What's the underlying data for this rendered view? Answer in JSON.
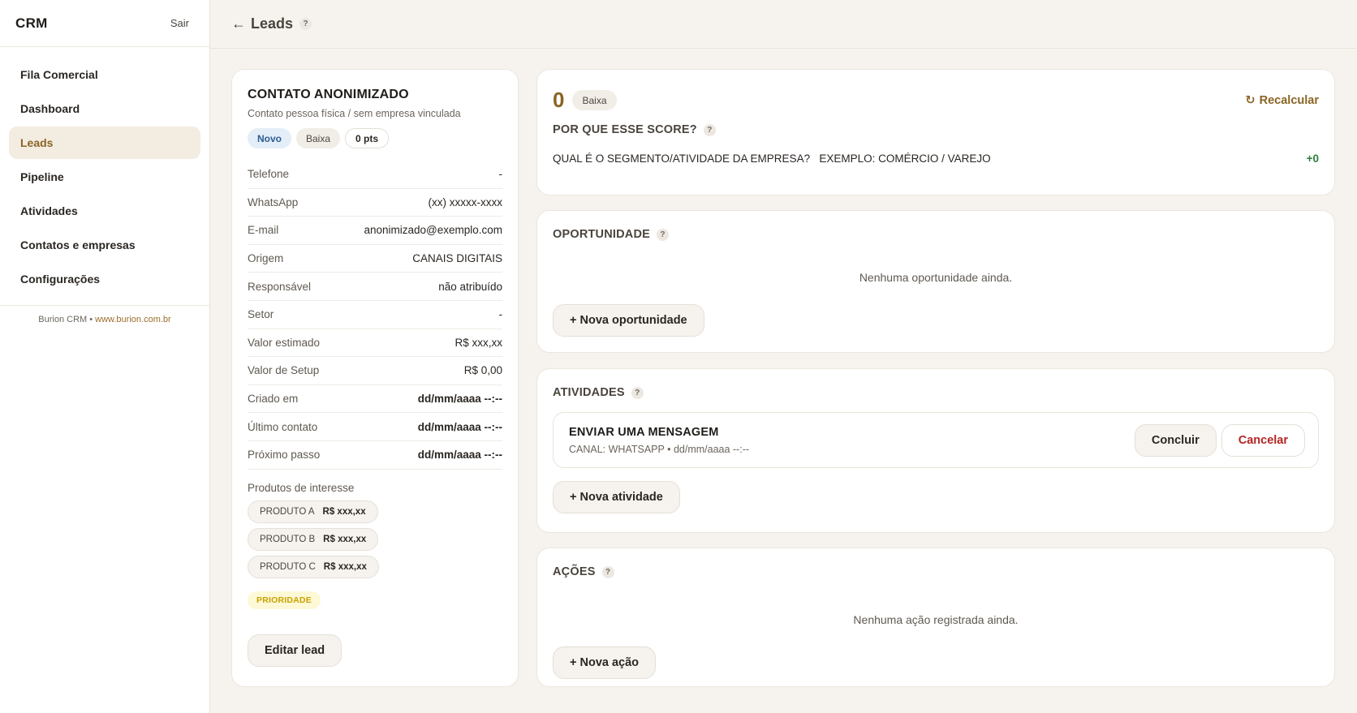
{
  "app": {
    "brand": "CRM",
    "logout": "Sair"
  },
  "sidebar": {
    "items": [
      {
        "label": "Fila Comercial"
      },
      {
        "label": "Dashboard"
      },
      {
        "label": "Leads"
      },
      {
        "label": "Pipeline"
      },
      {
        "label": "Atividades"
      },
      {
        "label": "Contatos e empresas"
      },
      {
        "label": "Configurações"
      }
    ],
    "active_index": 2,
    "footer_text": "Burion CRM • ",
    "footer_link": "www.burion.com.br"
  },
  "header": {
    "back_arrow": "←",
    "title": "Leads",
    "help": "?"
  },
  "lead": {
    "title": "CONTATO ANONIMIZADO",
    "subtitle": "Contato pessoa física / sem empresa vinculada",
    "badges": {
      "status": "Novo",
      "priority": "Baixa",
      "points": "0 pts"
    },
    "fields": [
      {
        "label": "Telefone",
        "value": "-"
      },
      {
        "label": "WhatsApp",
        "value": "(xx) xxxxx-xxxx"
      },
      {
        "label": "E-mail",
        "value": "anonimizado@exemplo.com"
      },
      {
        "label": "Origem",
        "value": "CANAIS DIGITAIS"
      },
      {
        "label": "Responsável",
        "value": "não atribuído"
      },
      {
        "label": "Setor",
        "value": "-"
      },
      {
        "label": "Valor estimado",
        "value": "R$ xxx,xx"
      },
      {
        "label": "Valor de Setup",
        "value": "R$ 0,00"
      },
      {
        "label": "Criado em",
        "value": "dd/mm/aaaa --:--"
      },
      {
        "label": "Último contato",
        "value": "dd/mm/aaaa --:--"
      },
      {
        "label": "Próximo passo",
        "value": "dd/mm/aaaa --:--"
      }
    ],
    "products_label": "Produtos de interesse",
    "products": [
      {
        "name": "PRODUTO A",
        "price": "R$ xxx,xx"
      },
      {
        "name": "PRODUTO B",
        "price": "R$ xxx,xx"
      },
      {
        "name": "PRODUTO C",
        "price": "R$ xxx,xx"
      }
    ],
    "tag": "PRIORIDADE",
    "edit_button": "Editar lead"
  },
  "score": {
    "value": "0",
    "level": "Baixa",
    "recalc_icon": "↻",
    "recalc_label": "Recalcular",
    "why_title": "POR QUE ESSE SCORE?",
    "help": "?",
    "row_question": "QUAL É O SEGMENTO/ATIVIDADE DA EMPRESA?",
    "row_answer": "EXEMPLO: COMÉRCIO / VAREJO",
    "row_points": "+0"
  },
  "opportunity": {
    "title": "OPORTUNIDADE",
    "help": "?",
    "empty": "Nenhuma oportunidade ainda.",
    "button": "+ Nova oportunidade"
  },
  "activities": {
    "title": "ATIVIDADES",
    "help": "?",
    "item": {
      "title": "ENVIAR UMA MENSAGEM",
      "meta": "CANAL: WHATSAPP • dd/mm/aaaa --:--",
      "complete": "Concluir",
      "cancel": "Cancelar"
    },
    "button": "+ Nova atividade"
  },
  "actions": {
    "title": "AÇÕES",
    "help": "?",
    "empty": "Nenhuma ação registrada ainda.",
    "button": "+ Nova ação"
  },
  "colors": {
    "accent": "#8a6424",
    "background": "#f6f3ee",
    "success": "#2f7d3d",
    "danger": "#b32424"
  }
}
